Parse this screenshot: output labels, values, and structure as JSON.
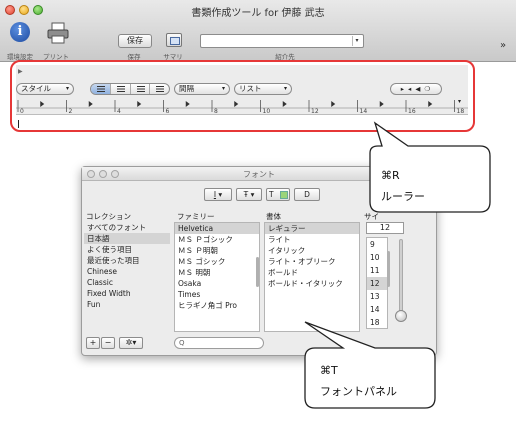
{
  "window": {
    "title": "書類作成ツール for 伊藤 武志",
    "toolbar": {
      "info_icon": "i",
      "save_label": "保存",
      "labels": [
        "環境設定",
        "プリント",
        "保存",
        "サマリ",
        "紹介先"
      ],
      "overflow": "»"
    }
  },
  "ruler": {
    "toggle": "▶",
    "style_select": "スタイル",
    "spacing_select": "間隔",
    "list_select": "リスト",
    "tab_stops": "▸ ◂ ◀ ❍",
    "ticks": [
      "0",
      "2",
      "4",
      "6",
      "8",
      "10",
      "12",
      "14",
      "16",
      "18"
    ]
  },
  "font_panel": {
    "title": "フォント",
    "toolbar": {
      "underline": "I",
      "strike": "Ŧ",
      "text_color": "T",
      "doc_color": "D",
      "arrow": "▾"
    },
    "headers": {
      "collection": "コレクション",
      "family": "ファミリー",
      "typeface": "書体",
      "size": "サイ"
    },
    "collections": [
      "すべてのフォント",
      "日本語",
      "よく使う項目",
      "最近使った項目",
      "Chinese",
      "Classic",
      "Fixed Width",
      "Fun"
    ],
    "selected_collection": 1,
    "families": [
      "Helvetica",
      "ＭＳ Ｐゴシック",
      "ＭＳ Ｐ明朝",
      "ＭＳ ゴシック",
      "ＭＳ 明朝",
      "Osaka",
      "Times",
      "ヒラギノ角ゴ Pro"
    ],
    "selected_family": 0,
    "typefaces": [
      "レギュラー",
      "ライト",
      "イタリック",
      "ライト・オブリーク",
      "ボールド",
      "ボールド・イタリック"
    ],
    "selected_typeface": 0,
    "size_value": "12",
    "sizes": [
      "9",
      "10",
      "11",
      "12",
      "13",
      "14",
      "18"
    ],
    "selected_size": 3,
    "bottom": {
      "add": "+",
      "remove": "−",
      "action": "✲▾",
      "search_icon": "Q"
    }
  },
  "callouts": {
    "ruler": {
      "shortcut": "⌘R",
      "label": "ルーラー"
    },
    "font_panel": {
      "shortcut": "⌘T",
      "label": "フォントパネル"
    }
  },
  "colors": {
    "highlight": "#e63737",
    "swatch": "#9ad47a",
    "selection": "#d4d4d4"
  },
  "icons": [
    "info-icon",
    "printer-icon",
    "summary-icon",
    "chevron-down-icon",
    "search-icon",
    "gear-icon"
  ]
}
